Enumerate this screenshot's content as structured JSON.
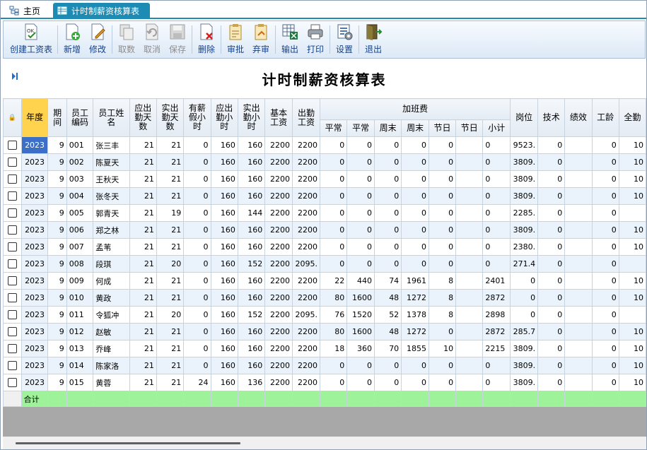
{
  "tabs": {
    "home": "主页",
    "active": "计时制薪资核算表"
  },
  "toolbar": [
    {
      "name": "create-payroll-button",
      "label": "创建工资表",
      "icon": "ok-doc-icon",
      "disabled": false
    },
    {
      "name": "add-button",
      "label": "新增",
      "icon": "add-doc-icon",
      "disabled": false
    },
    {
      "name": "edit-button",
      "label": "修改",
      "icon": "edit-doc-icon",
      "disabled": false
    },
    {
      "name": "fetch-button",
      "label": "取数",
      "icon": "copy-doc-icon",
      "disabled": true
    },
    {
      "name": "cancel-button",
      "label": "取消",
      "icon": "undo-icon",
      "disabled": true
    },
    {
      "name": "save-button",
      "label": "保存",
      "icon": "save-icon",
      "disabled": true
    },
    {
      "name": "delete-button",
      "label": "删除",
      "icon": "delete-doc-icon",
      "disabled": false
    },
    {
      "name": "approve-button",
      "label": "审批",
      "icon": "approve-icon",
      "disabled": false
    },
    {
      "name": "unapprove-button",
      "label": "弃审",
      "icon": "unapprove-icon",
      "disabled": false
    },
    {
      "name": "export-button",
      "label": "输出",
      "icon": "excel-export-icon",
      "disabled": false
    },
    {
      "name": "print-button",
      "label": "打印",
      "icon": "printer-icon",
      "disabled": false
    },
    {
      "name": "settings-button",
      "label": "设置",
      "icon": "settings-icon",
      "disabled": false
    },
    {
      "name": "exit-button",
      "label": "退出",
      "icon": "exit-door-icon",
      "disabled": false
    }
  ],
  "title": "计时制薪资核算表",
  "headers": {
    "lock": "🔒",
    "year": "年度",
    "period": "期间",
    "emp_no": "员工编码",
    "emp_name": "员工姓名",
    "due_days": "应出勤天数",
    "actual_days": "实出勤天数",
    "paid_leave": "有薪假小时",
    "due_hours": "应出勤小时",
    "actual_hours": "实出勤小时",
    "base": "基本工资",
    "attend": "出勤工资",
    "overtime_group": "加班费",
    "ot": [
      "平常",
      "平常",
      "周末",
      "周末",
      "节日",
      "节日",
      "小计"
    ],
    "post": "岗位",
    "skill": "技术",
    "perf": "绩效",
    "seniority": "工龄",
    "full": "全勤"
  },
  "rows": [
    [
      "2023",
      "9",
      "001",
      "张三丰",
      "21",
      "21",
      "0",
      "160",
      "160",
      "2200",
      "2200",
      "0",
      "0",
      "0",
      "0",
      "0",
      "",
      "0",
      "9523.",
      "0",
      "",
      "0",
      "10"
    ],
    [
      "2023",
      "9",
      "002",
      "陈夏天",
      "21",
      "21",
      "0",
      "160",
      "160",
      "2200",
      "2200",
      "0",
      "0",
      "0",
      "0",
      "0",
      "",
      "0",
      "3809.",
      "0",
      "",
      "0",
      "10"
    ],
    [
      "2023",
      "9",
      "003",
      "王秋天",
      "21",
      "21",
      "0",
      "160",
      "160",
      "2200",
      "2200",
      "0",
      "0",
      "0",
      "0",
      "0",
      "",
      "0",
      "3809.",
      "0",
      "",
      "0",
      "10"
    ],
    [
      "2023",
      "9",
      "004",
      "张冬天",
      "21",
      "21",
      "0",
      "160",
      "160",
      "2200",
      "2200",
      "0",
      "0",
      "0",
      "0",
      "0",
      "",
      "0",
      "3809.",
      "0",
      "",
      "0",
      "10"
    ],
    [
      "2023",
      "9",
      "005",
      "郭青天",
      "21",
      "19",
      "0",
      "160",
      "144",
      "2200",
      "2200",
      "0",
      "0",
      "0",
      "0",
      "0",
      "",
      "0",
      "2285.",
      "0",
      "",
      "0",
      ""
    ],
    [
      "2023",
      "9",
      "006",
      "郑之林",
      "21",
      "21",
      "0",
      "160",
      "160",
      "2200",
      "2200",
      "0",
      "0",
      "0",
      "0",
      "0",
      "",
      "0",
      "3809.",
      "0",
      "",
      "0",
      "10"
    ],
    [
      "2023",
      "9",
      "007",
      "孟苇",
      "21",
      "21",
      "0",
      "160",
      "160",
      "2200",
      "2200",
      "0",
      "0",
      "0",
      "0",
      "0",
      "",
      "0",
      "2380.",
      "0",
      "",
      "0",
      "10"
    ],
    [
      "2023",
      "9",
      "008",
      "段琪",
      "21",
      "20",
      "0",
      "160",
      "152",
      "2200",
      "2095.",
      "0",
      "0",
      "0",
      "0",
      "0",
      "",
      "0",
      "271.4",
      "0",
      "",
      "0",
      ""
    ],
    [
      "2023",
      "9",
      "009",
      "何成",
      "21",
      "21",
      "0",
      "160",
      "160",
      "2200",
      "2200",
      "22",
      "440",
      "74",
      "1961",
      "8",
      "",
      "2401",
      "0",
      "0",
      "",
      "0",
      "10"
    ],
    [
      "2023",
      "9",
      "010",
      "黄政",
      "21",
      "21",
      "0",
      "160",
      "160",
      "2200",
      "2200",
      "80",
      "1600",
      "48",
      "1272",
      "8",
      "",
      "2872",
      "0",
      "0",
      "",
      "0",
      "10"
    ],
    [
      "2023",
      "9",
      "011",
      "令狐冲",
      "21",
      "20",
      "0",
      "160",
      "152",
      "2200",
      "2095.",
      "76",
      "1520",
      "52",
      "1378",
      "8",
      "",
      "2898",
      "0",
      "0",
      "",
      "0",
      ""
    ],
    [
      "2023",
      "9",
      "012",
      "赵敏",
      "21",
      "21",
      "0",
      "160",
      "160",
      "2200",
      "2200",
      "80",
      "1600",
      "48",
      "1272",
      "0",
      "",
      "2872",
      "285.7",
      "0",
      "",
      "0",
      "10"
    ],
    [
      "2023",
      "9",
      "013",
      "乔峰",
      "21",
      "21",
      "0",
      "160",
      "160",
      "2200",
      "2200",
      "18",
      "360",
      "70",
      "1855",
      "10",
      "",
      "2215",
      "3809.",
      "0",
      "",
      "0",
      "10"
    ],
    [
      "2023",
      "9",
      "014",
      "陈家洛",
      "21",
      "21",
      "0",
      "160",
      "160",
      "2200",
      "2200",
      "0",
      "0",
      "0",
      "0",
      "0",
      "",
      "0",
      "3809.",
      "0",
      "",
      "0",
      "10"
    ],
    [
      "2023",
      "9",
      "015",
      "黄蓉",
      "21",
      "21",
      "24",
      "160",
      "136",
      "2200",
      "2200",
      "0",
      "0",
      "0",
      "0",
      "0",
      "",
      "0",
      "3809.",
      "0",
      "",
      "0",
      "10"
    ]
  ],
  "total_label": "合计",
  "colors": {
    "accent": "#1e8bb5",
    "year_header": "#ffd34d",
    "selected_cell": "#3b6fc8",
    "total_row": "#9ef39a"
  }
}
